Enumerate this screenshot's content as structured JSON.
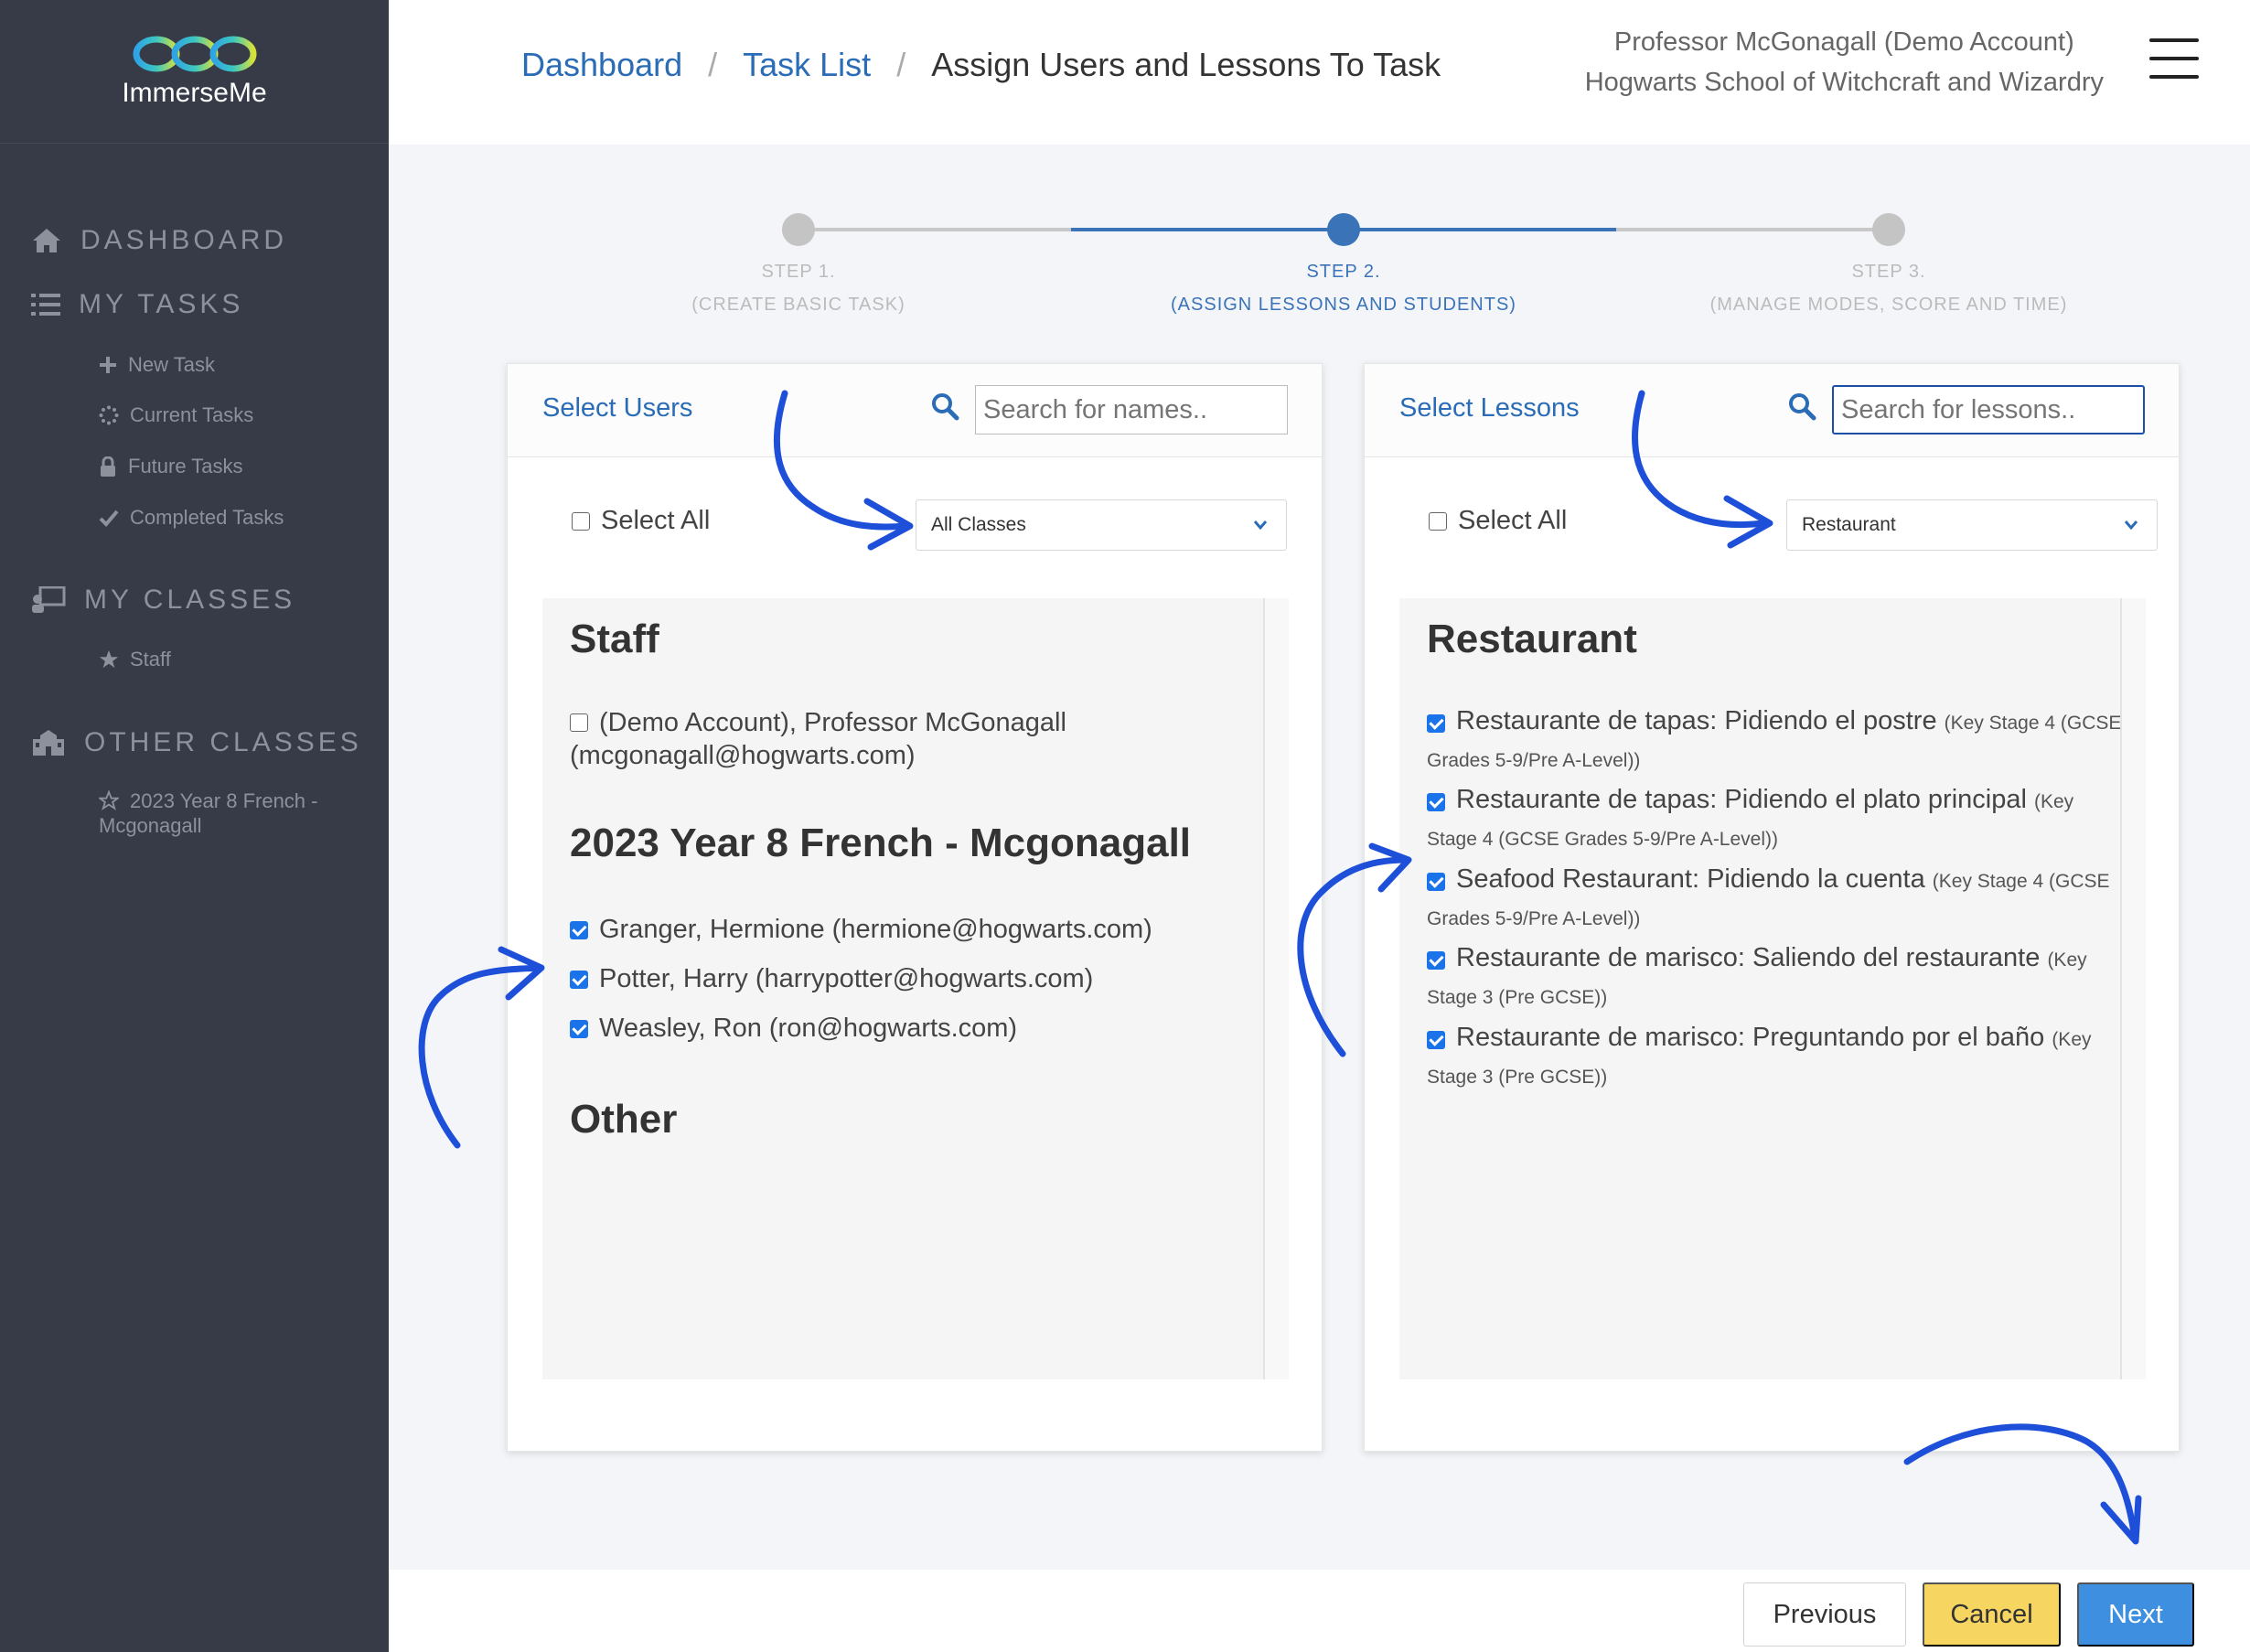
{
  "app": {
    "name": "ImmerseMe"
  },
  "sidebar": {
    "sections": [
      {
        "label": "DASHBOARD"
      },
      {
        "label": "MY TASKS",
        "items": [
          {
            "label": "New Task"
          },
          {
            "label": "Current Tasks"
          },
          {
            "label": "Future Tasks"
          },
          {
            "label": "Completed Tasks"
          }
        ]
      },
      {
        "label": "MY CLASSES",
        "items": [
          {
            "label": "Staff"
          }
        ]
      },
      {
        "label": "OTHER CLASSES",
        "items": [
          {
            "label_line1": "2023 Year 8 French -",
            "label_line2": "Mcgonagall"
          }
        ]
      }
    ]
  },
  "header": {
    "breadcrumb": {
      "link1": "Dashboard",
      "link2": "Task List",
      "current": "Assign Users and Lessons To Task",
      "sep": "/"
    },
    "user_name": "Professor McGonagall (Demo Account)",
    "school": "Hogwarts School of Witchcraft and Wizardry"
  },
  "stepper": {
    "steps": [
      {
        "title": "STEP 1.",
        "subtitle": "(CREATE BASIC TASK)",
        "state": "done"
      },
      {
        "title": "STEP 2.",
        "subtitle": "(ASSIGN LESSONS AND STUDENTS)",
        "state": "active"
      },
      {
        "title": "STEP 3.",
        "subtitle": "(MANAGE MODES, SCORE AND TIME)",
        "state": "todo"
      }
    ]
  },
  "users_panel": {
    "title": "Select Users",
    "search_placeholder": "Search for names..",
    "select_all": "Select All",
    "filter_value": "All Classes",
    "groups": [
      {
        "title": "Staff",
        "users": [
          {
            "line1": "(Demo Account), Professor McGonagall",
            "line2": "(mcgonagall@hogwarts.com)",
            "checked": false
          }
        ]
      },
      {
        "title": "2023 Year 8 French - Mcgonagall",
        "users": [
          {
            "label": "Granger, Hermione (hermione@hogwarts.com)",
            "checked": true
          },
          {
            "label": "Potter, Harry (harrypotter@hogwarts.com)",
            "checked": true
          },
          {
            "label": "Weasley, Ron (ron@hogwarts.com)",
            "checked": true
          }
        ]
      },
      {
        "title": "Other",
        "users": []
      }
    ]
  },
  "lessons_panel": {
    "title": "Select Lessons",
    "search_placeholder": "Search for lessons..",
    "select_all": "Select All",
    "filter_value": "Restaurant",
    "group_title": "Restaurant",
    "lessons": [
      {
        "name": "Restaurante de tapas: Pidiendo el postre",
        "level": "(Key Stage 4 (GCSE Grades 5-9/Pre A-Level))",
        "checked": true
      },
      {
        "name": "Restaurante de tapas: Pidiendo el plato principal",
        "level": "(Key Stage 4 (GCSE Grades 5-9/Pre A-Level))",
        "checked": true
      },
      {
        "name": "Seafood Restaurant: Pidiendo la cuenta",
        "level": "(Key Stage 4 (GCSE Grades 5-9/Pre A-Level))",
        "checked": true
      },
      {
        "name": "Restaurante de marisco: Saliendo del restaurante",
        "level": "(Key Stage 3 (Pre GCSE))",
        "checked": true
      },
      {
        "name": "Restaurante de marisco: Preguntando por el baño",
        "level": "(Key Stage 3 (Pre GCSE))",
        "checked": true
      }
    ]
  },
  "footer": {
    "previous": "Previous",
    "cancel": "Cancel",
    "next": "Next"
  },
  "colors": {
    "sidebar_bg": "#363b47",
    "link_blue": "#2b6cb7",
    "next_btn": "#3e8fe0",
    "cancel_btn": "#f7d561",
    "annotation_blue": "#1e4fd8"
  }
}
